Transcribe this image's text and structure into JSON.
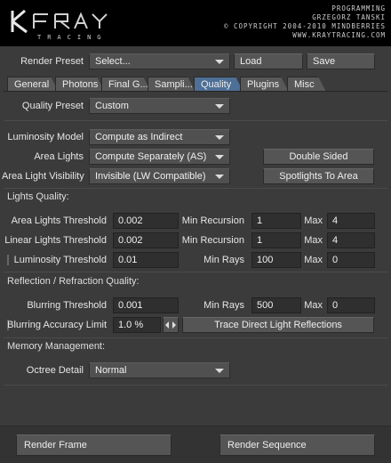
{
  "header": {
    "logo_text": "KRAY",
    "logo_subtext": "TRACING",
    "credit_line1": "PROGRAMMING",
    "credit_line2": "GRZEGORZ TANSKI",
    "credit_line3": "© COPYRIGHT 2004-2010 MINDBERRIES",
    "credit_line4": "WWW.KRAYTRACING.COM"
  },
  "render_preset": {
    "label": "Render Preset",
    "value": "Select...",
    "load_label": "Load",
    "save_label": "Save"
  },
  "tabs": [
    {
      "label": "General",
      "active": false
    },
    {
      "label": "Photons",
      "active": false
    },
    {
      "label": "Final G...",
      "active": false
    },
    {
      "label": "Sampli...",
      "active": false
    },
    {
      "label": "Quality",
      "active": true
    },
    {
      "label": "Plugins",
      "active": false
    },
    {
      "label": "Misc",
      "active": false
    }
  ],
  "quality_preset": {
    "label": "Quality Preset",
    "value": "Custom"
  },
  "luminosity_model": {
    "label": "Luminosity Model",
    "value": "Compute as Indirect"
  },
  "area_lights": {
    "label": "Area Lights",
    "value": "Compute Separately (AS)"
  },
  "area_light_visibility": {
    "label": "Area Light Visibility",
    "value": "Invisible (LW Compatible)"
  },
  "double_sided_label": "Double Sided",
  "spotlights_to_area_label": "Spotlights To Area",
  "lights_quality": {
    "section_label": "Lights Quality:",
    "rows": [
      {
        "label": "Area Lights Threshold",
        "threshold": "0.002",
        "mid_label": "Min Recursion",
        "mid_value": "1",
        "max_label": "Max",
        "max_value": "4"
      },
      {
        "label": "Linear Lights Threshold",
        "threshold": "0.002",
        "mid_label": "Min Recursion",
        "mid_value": "1",
        "max_label": "Max",
        "max_value": "4"
      },
      {
        "label": "Luminosity Threshold",
        "threshold": "0.01",
        "mid_label": "Min Rays",
        "mid_value": "100",
        "max_label": "Max",
        "max_value": "0"
      }
    ]
  },
  "reflection": {
    "section_label": "Reflection / Refraction Quality:",
    "blurring_threshold": {
      "label": "Blurring Threshold",
      "value": "0.001",
      "mid_label": "Min Rays",
      "mid_value": "500",
      "max_label": "Max",
      "max_value": "0"
    },
    "blurring_accuracy": {
      "label": "Blurring Accuracy Limit",
      "value": "1.0 %"
    },
    "trace_direct_label": "Trace Direct Light Reflections"
  },
  "memory": {
    "section_label": "Memory Management:",
    "octree_label": "Octree Detail",
    "octree_value": "Normal"
  },
  "bottom": {
    "render_frame_label": "Render Frame",
    "render_sequence_label": "Render Sequence"
  }
}
